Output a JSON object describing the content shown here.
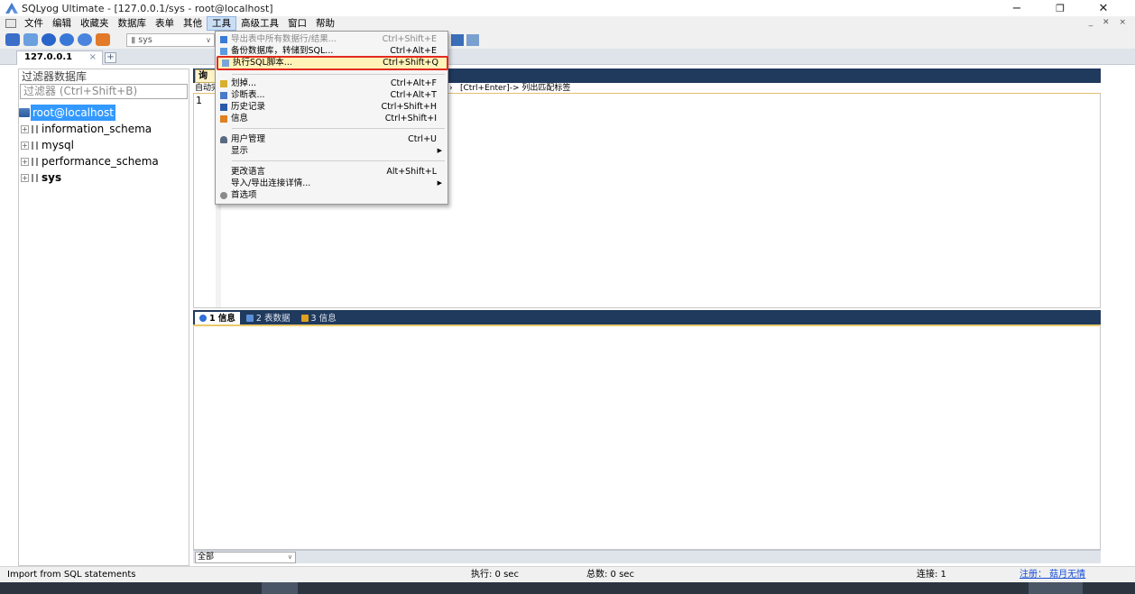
{
  "window": {
    "title": "SQLyog Ultimate - [127.0.0.1/sys - root@localhost]",
    "minimize": "−",
    "restore": "❐",
    "close": "✕"
  },
  "menubar": {
    "items": [
      "文件",
      "编辑",
      "收藏夹",
      "数据库",
      "表单",
      "其他",
      "工具",
      "高级工具",
      "窗口",
      "帮助"
    ],
    "active_index": 6,
    "mdi_controls": "_ ✕ ×"
  },
  "toolbar": {
    "db_selector_value": "sys",
    "db_selector_arrow": "∨"
  },
  "connection_tab": {
    "label": "127.0.0.1",
    "close": "×",
    "add": "+"
  },
  "left_panel": {
    "header": "过滤器数据库",
    "filter_placeholder": "过滤器 (Ctrl+Shift+B)",
    "root": "root@localhost",
    "databases": [
      {
        "name": "information_schema",
        "bold": false
      },
      {
        "name": "mysql",
        "bold": false
      },
      {
        "name": "performance_schema",
        "bold": false
      },
      {
        "name": "sys",
        "bold": true
      }
    ],
    "expander": "+"
  },
  "editor": {
    "tab_label": "询",
    "autocomplete_left": "自动完",
    "autocomplete_right": "[Ctrl+Enter]-> 列出匹配标签",
    "autocomplete_arrow": "›",
    "line_number": "1"
  },
  "result_tabs": [
    {
      "label": "1 信息",
      "active": true,
      "color": "#2f6fd6"
    },
    {
      "label": "2 表数据",
      "active": false,
      "color": "#5a8fd8"
    },
    {
      "label": "3 信息",
      "active": false,
      "color": "#e0a020"
    }
  ],
  "bottom_filter": {
    "value": "全部",
    "arrow": "∨"
  },
  "statusbar": {
    "left": "Import from SQL statements",
    "exec": "执行: 0 sec",
    "total": "总数: 0 sec",
    "connections": "连接: 1",
    "register": "注册： 菇月无情"
  },
  "dropdown": {
    "items": [
      {
        "label": "导出表中所有数据行/结果...",
        "shortcut": "Ctrl+Shift+E",
        "disabled": true,
        "icon_color": "#3a7ad8"
      },
      {
        "label": "备份数据库，转储到SQL...",
        "shortcut": "Ctrl+Alt+E",
        "disabled": false,
        "icon_color": "#5a9ae0"
      },
      {
        "label": "执行SQL脚本...",
        "shortcut": "Ctrl+Shift+Q",
        "disabled": false,
        "highlight": true,
        "icon_color": "#7aa4d8"
      },
      {
        "label": "划掉...",
        "shortcut": "Ctrl+Alt+F",
        "disabled": false,
        "icon_color": "#d8b030"
      },
      {
        "label": "诊断表...",
        "shortcut": "Ctrl+Alt+T",
        "disabled": false,
        "icon_color": "#4a7ac8"
      },
      {
        "label": "历史记录",
        "shortcut": "Ctrl+Shift+H",
        "disabled": false,
        "icon_color": "#2a5aa8"
      },
      {
        "label": "信息",
        "shortcut": "Ctrl+Shift+I",
        "disabled": false,
        "icon_color": "#e08020"
      },
      {
        "label": "用户管理",
        "shortcut": "Ctrl+U",
        "disabled": false,
        "icon_color": "#5a6a80"
      },
      {
        "label": "显示",
        "shortcut": "",
        "submenu": true,
        "disabled": false
      },
      {
        "label": "更改语言",
        "shortcut": "Alt+Shift+L",
        "disabled": false
      },
      {
        "label": "导入/导出连接详情...",
        "shortcut": "",
        "submenu": true,
        "disabled": false
      },
      {
        "label": "首选项",
        "shortcut": "",
        "disabled": false,
        "icon_color": "#8a8a8a"
      }
    ],
    "submenu_arrow": "▶"
  }
}
